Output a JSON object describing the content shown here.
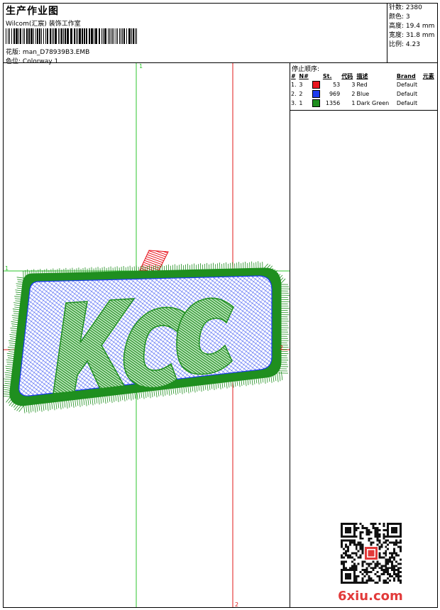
{
  "header": {
    "title": "生产作业图",
    "studio": "Wilcom(汇宸) 装饰工作室",
    "design_label": "花版:",
    "design_file": "man_D78939B3.EMB",
    "colorway_label": "色位:",
    "colorway": "Colorway 1"
  },
  "stats": [
    {
      "label": "针数:",
      "value": "2380"
    },
    {
      "label": "颜色:",
      "value": "3"
    },
    {
      "label": "高度:",
      "value": "19.4 mm"
    },
    {
      "label": "宽度:",
      "value": "31.8 mm"
    },
    {
      "label": "比例:",
      "value": "4.23"
    }
  ],
  "stop_sequence": {
    "label": "停止顺序:",
    "columns": [
      "#",
      "N#",
      "St.",
      "代码",
      "描述",
      "Brand",
      "元素"
    ],
    "rows": [
      {
        "idx": "1.",
        "n": "3",
        "color": "#e8141e",
        "st": "53",
        "code": "3",
        "desc": "Red",
        "brand": "Default"
      },
      {
        "idx": "2.",
        "n": "2",
        "color": "#1e3cf0",
        "st": "969",
        "code": "2",
        "desc": "Blue",
        "brand": "Default"
      },
      {
        "idx": "3.",
        "n": "1",
        "color": "#1f8f1f",
        "st": "1356",
        "code": "1",
        "desc": "Dark Green",
        "brand": "Default"
      }
    ]
  },
  "artwork": {
    "lettering": "KCC",
    "guide_colors": {
      "green": "#2cc42c",
      "red": "#e01818"
    },
    "guide_labels": {
      "green_top": "1",
      "green_left": "1",
      "red_right": "2",
      "red_bottom": "2"
    }
  },
  "watermark": "6xiu.com"
}
